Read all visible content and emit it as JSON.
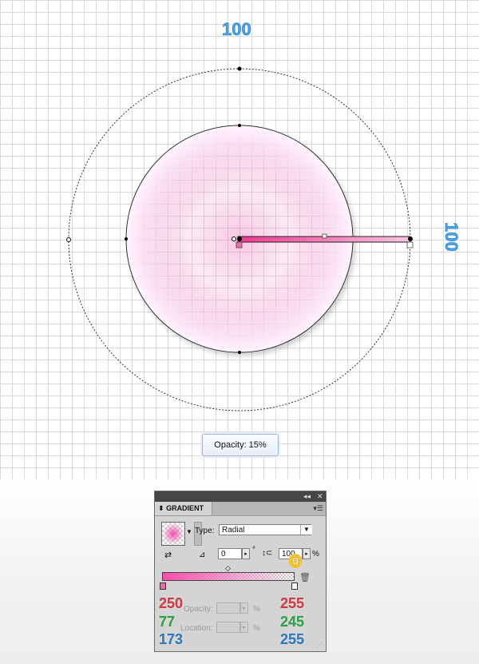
{
  "canvas": {
    "dim_top": "100",
    "dim_right": "100",
    "tooltip_text": "Opacity: 15%"
  },
  "panel": {
    "collapse_icon": "◂◂",
    "close_icon": "✕",
    "tab_arrow": "⬍",
    "tab_label": "GRADIENT",
    "menu_icon": "▾☰",
    "type_label": "Type:",
    "type_value": "Radial",
    "angle_value": "0",
    "degree_symbol": "°",
    "aspect_value": "100",
    "percent_symbol": "%",
    "opacity_label": "Opacity:",
    "location_label": "Location:",
    "trash_icon": "trash-icon"
  },
  "annotations": {
    "left_stop": {
      "r": "250",
      "g": "77",
      "b": "173"
    },
    "right_stop": {
      "r": "255",
      "g": "245",
      "b": "255"
    },
    "right_stop_opacity": "0"
  },
  "colors": {
    "gradient_start": "#fa4dad",
    "gradient_end": "#fff5ff"
  }
}
